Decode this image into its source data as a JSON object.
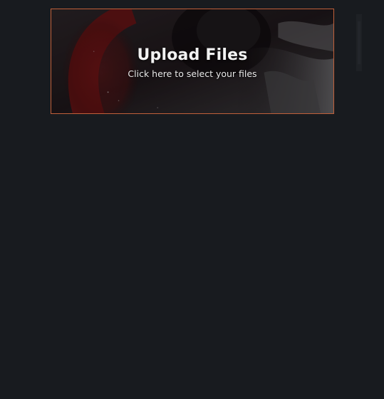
{
  "upload": {
    "title": "Upload Files",
    "subtitle": "Click here to select your files",
    "border_color": "#c0603a",
    "background_art": "astronaut-with-red-planet-image"
  },
  "page": {
    "background_color": "#181b1f"
  }
}
